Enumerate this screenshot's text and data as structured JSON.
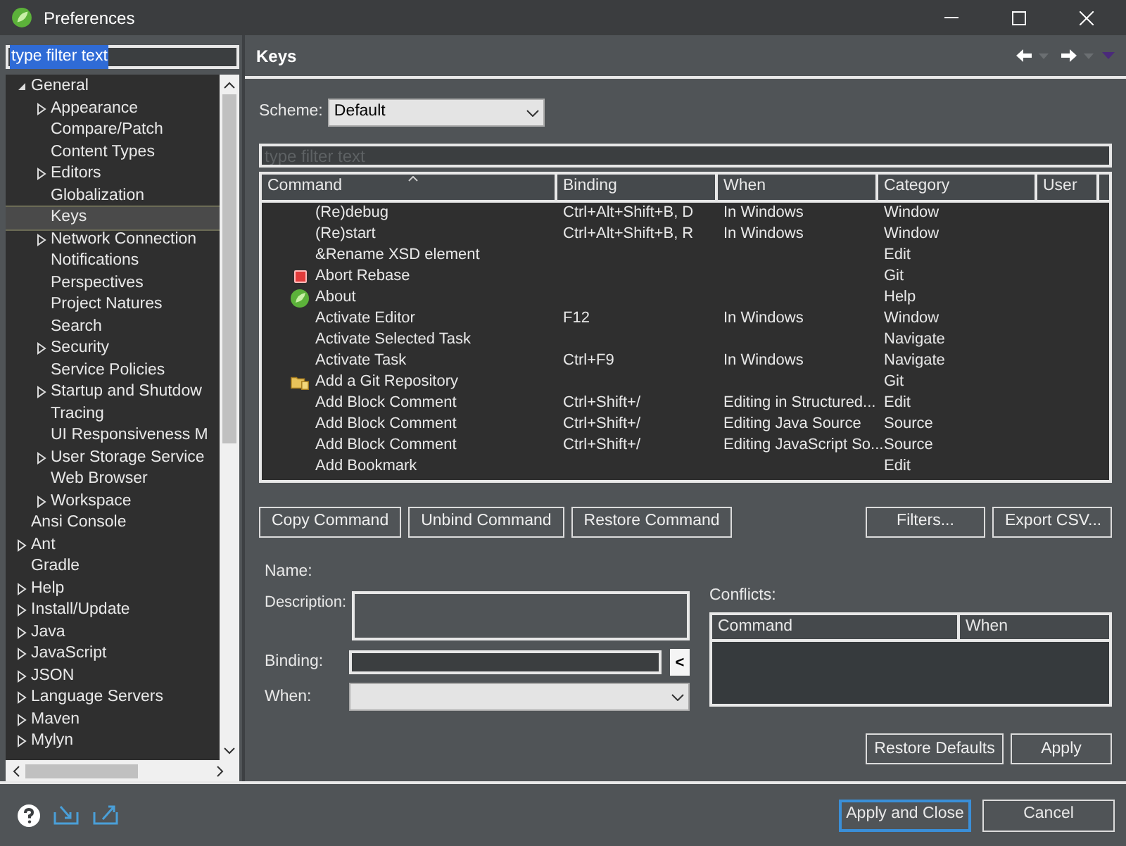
{
  "window": {
    "title": "Preferences"
  },
  "filter": {
    "value": "type filter text",
    "text_selected": true
  },
  "tree": [
    {
      "label": "General",
      "kind": "branch",
      "expanded": true,
      "selected": false,
      "children": [
        {
          "label": "Appearance",
          "kind": "branch",
          "expanded": false,
          "selected": false
        },
        {
          "label": "Compare/Patch",
          "kind": "leaf",
          "selected": false
        },
        {
          "label": "Content Types",
          "kind": "leaf",
          "selected": false
        },
        {
          "label": "Editors",
          "kind": "branch",
          "expanded": false,
          "selected": false
        },
        {
          "label": "Globalization",
          "kind": "leaf",
          "selected": false
        },
        {
          "label": "Keys",
          "kind": "leaf",
          "selected": true
        },
        {
          "label": "Network Connection",
          "kind": "branch",
          "expanded": false,
          "selected": false
        },
        {
          "label": "Notifications",
          "kind": "leaf",
          "selected": false
        },
        {
          "label": "Perspectives",
          "kind": "leaf",
          "selected": false
        },
        {
          "label": "Project Natures",
          "kind": "leaf",
          "selected": false
        },
        {
          "label": "Search",
          "kind": "leaf",
          "selected": false
        },
        {
          "label": "Security",
          "kind": "branch",
          "expanded": false,
          "selected": false
        },
        {
          "label": "Service Policies",
          "kind": "leaf",
          "selected": false
        },
        {
          "label": "Startup and Shutdow",
          "kind": "branch",
          "expanded": false,
          "selected": false
        },
        {
          "label": "Tracing",
          "kind": "leaf",
          "selected": false
        },
        {
          "label": "UI Responsiveness M",
          "kind": "leaf",
          "selected": false
        },
        {
          "label": "User Storage Service",
          "kind": "branch",
          "expanded": false,
          "selected": false
        },
        {
          "label": "Web Browser",
          "kind": "leaf",
          "selected": false
        },
        {
          "label": "Workspace",
          "kind": "branch",
          "expanded": false,
          "selected": false
        }
      ]
    },
    {
      "label": "Ansi Console",
      "kind": "leaf",
      "selected": false
    },
    {
      "label": "Ant",
      "kind": "branch",
      "expanded": false,
      "selected": false
    },
    {
      "label": "Gradle",
      "kind": "leaf",
      "selected": false
    },
    {
      "label": "Help",
      "kind": "branch",
      "expanded": false,
      "selected": false
    },
    {
      "label": "Install/Update",
      "kind": "branch",
      "expanded": false,
      "selected": false
    },
    {
      "label": "Java",
      "kind": "branch",
      "expanded": false,
      "selected": false
    },
    {
      "label": "JavaScript",
      "kind": "branch",
      "expanded": false,
      "selected": false
    },
    {
      "label": "JSON",
      "kind": "branch",
      "expanded": false,
      "selected": false
    },
    {
      "label": "Language Servers",
      "kind": "branch",
      "expanded": false,
      "selected": false
    },
    {
      "label": "Maven",
      "kind": "branch",
      "expanded": false,
      "selected": false
    },
    {
      "label": "Mylyn",
      "kind": "branch",
      "expanded": false,
      "selected": false
    }
  ],
  "page": {
    "title": "Keys",
    "scheme_label": "Scheme:",
    "scheme_value": "Default",
    "filter_placeholder": "type filter text"
  },
  "table": {
    "columns": [
      {
        "label": "Command",
        "sorted": true
      },
      {
        "label": "Binding",
        "sorted": false
      },
      {
        "label": "When",
        "sorted": false
      },
      {
        "label": "Category",
        "sorted": false
      },
      {
        "label": "User",
        "sorted": false
      }
    ],
    "rows": [
      {
        "kind": "text",
        "command": "(Re)debug",
        "binding": "Ctrl+Alt+Shift+B, D",
        "when": "In Windows",
        "category": "Window"
      },
      {
        "kind": "text",
        "command": "(Re)start",
        "binding": "Ctrl+Alt+Shift+B, R",
        "when": "In Windows",
        "category": "Window"
      },
      {
        "kind": "text",
        "command": "&Rename XSD element",
        "category": "Edit"
      },
      {
        "kind": "stop",
        "command": "Abort Rebase",
        "category": "Git"
      },
      {
        "kind": "logo",
        "command": "About",
        "category": "Help"
      },
      {
        "kind": "text",
        "command": "Activate Editor",
        "binding": "F12",
        "when": "In Windows",
        "category": "Window"
      },
      {
        "kind": "text",
        "command": "Activate Selected Task",
        "category": "Navigate"
      },
      {
        "kind": "text",
        "command": "Activate Task",
        "binding": "Ctrl+F9",
        "when": "In Windows",
        "category": "Navigate"
      },
      {
        "kind": "repo",
        "command": "Add a Git Repository",
        "category": "Git"
      },
      {
        "kind": "text",
        "command": "Add Block Comment",
        "binding": "Ctrl+Shift+/",
        "when": "Editing in Structured...",
        "category": "Edit"
      },
      {
        "kind": "text",
        "command": "Add Block Comment",
        "binding": "Ctrl+Shift+/",
        "when": "Editing Java Source",
        "category": "Source"
      },
      {
        "kind": "text",
        "command": "Add Block Comment",
        "binding": "Ctrl+Shift+/",
        "when": "Editing JavaScript So...",
        "category": "Source"
      },
      {
        "kind": "text",
        "command": "Add Bookmark",
        "category": "Edit"
      }
    ]
  },
  "table_buttons_left": [
    "Copy Command",
    "Unbind Command",
    "Restore Command"
  ],
  "table_buttons_right": [
    "Filters...",
    "Export CSV..."
  ],
  "details": {
    "name_label": "Name:",
    "description_label": "Description:",
    "binding_label": "Binding:",
    "binding_button": "<",
    "when_label": "When:",
    "conflicts_label": "Conflicts:",
    "conflict_columns": [
      "Command",
      "When"
    ]
  },
  "page_buttons": [
    "Restore Defaults",
    "Apply"
  ],
  "footer_buttons": [
    {
      "label": "Apply and Close",
      "default": true
    },
    {
      "label": "Cancel",
      "default": false
    }
  ]
}
